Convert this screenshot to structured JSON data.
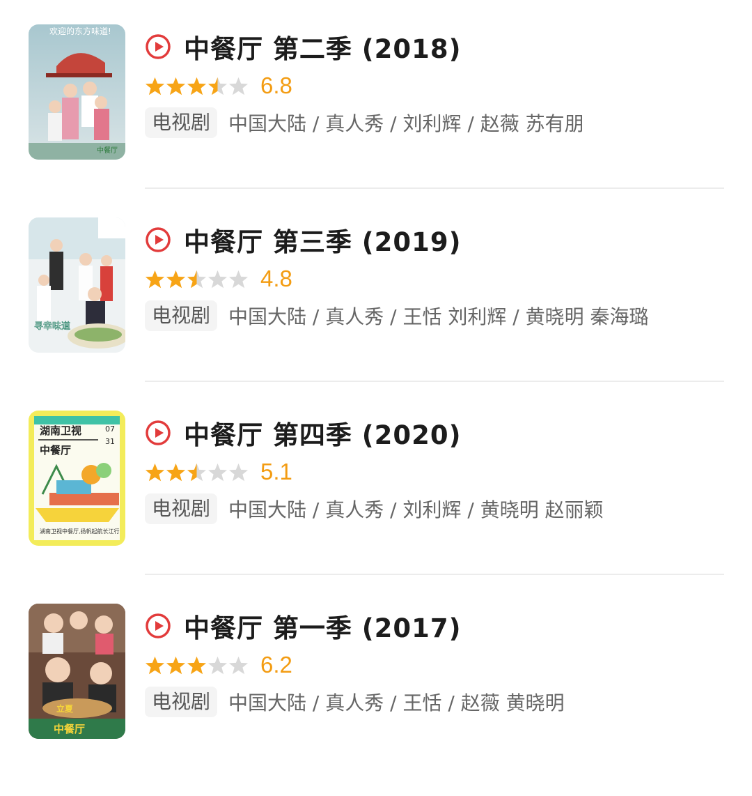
{
  "colors": {
    "accent_red": "#e23b3b",
    "star_gold": "#f7a416",
    "star_gray": "#d8d8d8",
    "score": "#f39c12"
  },
  "items": [
    {
      "title": "中餐厅 第二季 (2018)",
      "score": "6.8",
      "stars": 3.5,
      "tag": "电视剧",
      "meta": "中国大陆 / 真人秀 / 刘利辉 / 赵薇 苏有朋",
      "poster_text": "欢迎的东方味道!",
      "poster_badge": "中餐厅"
    },
    {
      "title": "中餐厅 第三季 (2019)",
      "score": "4.8",
      "stars": 2.5,
      "tag": "电视剧",
      "meta": "中国大陆 / 真人秀 / 王恬 刘利辉 / 黄晓明 秦海璐",
      "poster_text": "寻幸味道",
      "poster_badge": ""
    },
    {
      "title": "中餐厅 第四季 (2020)",
      "score": "5.1",
      "stars": 2.5,
      "tag": "电视剧",
      "meta": "中国大陆 / 真人秀 / 刘利辉 / 黄晓明 赵丽颖",
      "poster_text": "湖南卫视",
      "poster_sub": "中餐厅",
      "poster_date_top": "07",
      "poster_date_bottom": "31",
      "poster_badge": "湖南卫视中餐厅,扬帆起航长江行"
    },
    {
      "title": "中餐厅 第一季 (2017)",
      "score": "6.2",
      "stars": 3,
      "tag": "电视剧",
      "meta": "中国大陆 / 真人秀 / 王恬 / 赵薇 黄晓明",
      "poster_text": "中餐厅",
      "poster_badge": "立夏"
    }
  ]
}
